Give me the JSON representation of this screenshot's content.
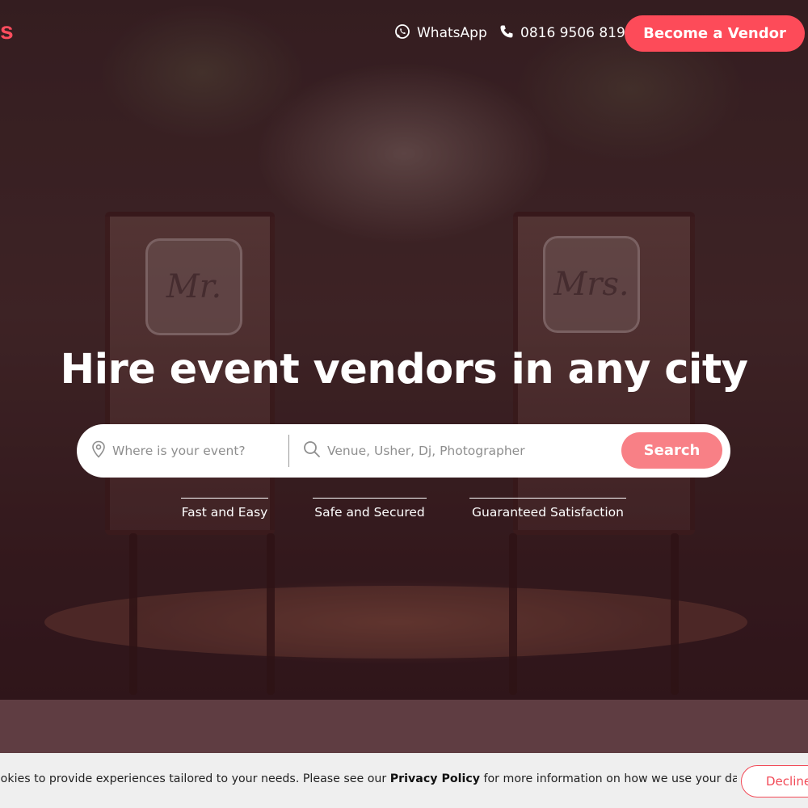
{
  "header": {
    "logo_fragment": "s",
    "whatsapp_label": "WhatsApp",
    "phone_label": "0816 9506 819",
    "vendor_button": "Become a Vendor"
  },
  "hero": {
    "chair_sign_left": "Mr.",
    "chair_sign_right": "Mrs.",
    "title": "Hire event vendors in any city"
  },
  "search": {
    "location_placeholder": "Where is your event?",
    "service_placeholder": "Venue, Usher, Dj, Photographer",
    "button_label": "Search"
  },
  "features": [
    {
      "label": "Fast and Easy"
    },
    {
      "label": "Safe and Secured"
    },
    {
      "label": "Guaranteed Satisfaction"
    }
  ],
  "cookie_banner": {
    "text_before": "ookies to provide experiences tailored to your needs. Please see our ",
    "link_text": "Privacy Policy",
    "text_after": " for more information on how we use your data.",
    "decline_label": "Decline"
  },
  "colors": {
    "accent": "#fd4b59",
    "search_button": "#f88086",
    "cookie_background": "#efefef",
    "lower_band": "#5f3d42"
  },
  "icons": {
    "whatsapp": "whatsapp-icon",
    "phone": "phone-icon",
    "location": "location-pin-icon",
    "search": "search-icon"
  }
}
